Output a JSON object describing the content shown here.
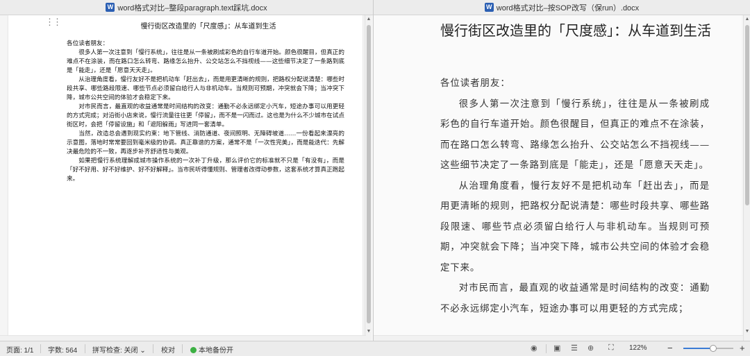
{
  "left_window": {
    "title": "word格式对比–整段paragraph.text踩坑.docx",
    "doc_title": "慢行街区改造里的「尺度感」：从车道到生活",
    "salutation": "各位读者朋友：",
    "paragraphs": [
      "很多人第一次注意到「慢行系统」，往往是从一条被刷成彩色的自行车道开始。颜色很醒目，但真正的难点不在涂装，而在路口怎么转弯、路缘怎么抬升、公交站怎么不挡视线——这些细节决定了一条路到底是「能走」，还是「愿意天天走」。",
      "从治理角度看，慢行友好不是把机动车「赶出去」，而是用更清晰的规则，把路权分配说清楚：哪些时段共享、哪些路段限速、哪些节点必须留白给行人与非机动车。当规则可预期，冲突就会下降；当冲突下降，城市公共空间的体验才会稳定下来。",
      "对市民而言，最直观的收益通常是时间结构的改变：通勤不必永远绑定小汽车，短途办事可以用更轻的方式完成；对沿街小店来说，慢行流量往往更「停留」，而不是一闪而过。这也是为什么不少城市在试点街区时，会把「停留设施」和「遮阳躲雨」写进同一套清单。",
      "当然，改造总会遇到现实约束：地下管线、消防通道、夜间照明、无障碍坡道……一份看起来漂亮的示意图，落地时常常要回到毫米级的协调。真正靠谱的方案，通常不是「一次性完美」，而是能迭代：先解决最危险的不一致，再逐步补齐舒适性与美观。",
      "如果把慢行系统理解成城市操作系统的一次补丁升级，那么评价它的标准就不只是「有没有」，而是「好不好用、好不好维护、好不好解释」。当市民听得懂规则、管理者改得动参数，这套系统才算真正跑起来。"
    ]
  },
  "right_window": {
    "title": "word格式对比–按SOP改写（保run）.docx",
    "doc_title": "慢行街区改造里的「尺度感」：从车道到生活",
    "salutation": "各位读者朋友：",
    "paragraphs": [
      "很多人第一次注意到「慢行系统」，往往是从一条被刷成彩色的自行车道开始。颜色很醒目，但真正的难点不在涂装，而在路口怎么转弯、路缘怎么抬升、公交站怎么不挡视线——这些细节决定了一条路到底是「能走」，还是「愿意天天走」。",
      "从治理角度看，慢行友好不是把机动车「赶出去」，而是用更清晰的规则，把路权分配说清楚：哪些时段共享、哪些路段限速、哪些节点必须留白给行人与非机动车。当规则可预期，冲突就会下降；当冲突下降，城市公共空间的体验才会稳定下来。",
      "对市民而言，最直观的收益通常是时间结构的改变：通勤不必永远绑定小汽车，短途办事可以用更轻的方式完成；"
    ]
  },
  "statusbar": {
    "page": "页面: 1/1",
    "word_count": "字数: 564",
    "spellcheck": "拼写检查: 关闭",
    "spellcheck_arrow": "⌄",
    "proofread": "校对",
    "backup": "本地备份开",
    "zoom": "122%",
    "zoom_minus": "−",
    "zoom_plus": "+",
    "zoom_level": 0.6
  },
  "icons": {
    "app_icon_letter": "W",
    "eye": "◉",
    "page_view": "▣",
    "layout": "☰",
    "web": "⊕",
    "focus": "⛶"
  },
  "colors": {
    "backup_dot": "#3cb043",
    "app_icon": "#2b5fb3",
    "zoom_fill": "#3a7bd5"
  }
}
